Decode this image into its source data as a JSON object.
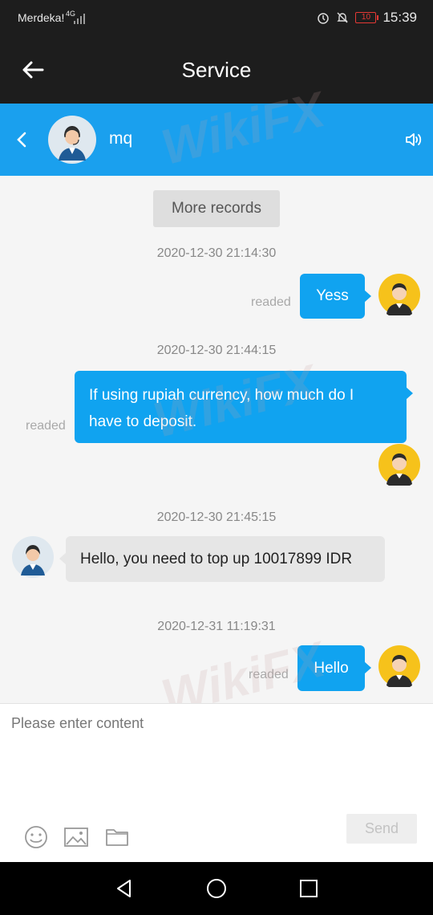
{
  "status_bar": {
    "carrier": "Merdeka!",
    "network": "4G",
    "battery": "10",
    "time": "15:39"
  },
  "title_bar": {
    "title": "Service"
  },
  "agent": {
    "name": "mq"
  },
  "chat": {
    "more_records": "More records",
    "messages": [
      {
        "time": "2020-12-30 21:14:30",
        "text": "Yess",
        "status": "readed"
      },
      {
        "time": "2020-12-30 21:44:15",
        "text_line1": "If using rupiah currency, how much do I",
        "text_line2": "have to deposit.",
        "status": "readed"
      },
      {
        "time": "2020-12-30 21:45:15",
        "text": "Hello, you need to top up 10017899 IDR"
      },
      {
        "time": "2020-12-31 11:19:31",
        "text": "Hello",
        "status": "readed"
      }
    ]
  },
  "watermark": "WikiFX",
  "input": {
    "placeholder": "Please enter content",
    "send_label": "Send"
  },
  "colors": {
    "accent": "#1aa0ee",
    "bubble_out": "#10a3f0",
    "bubble_in": "#e6e6e6",
    "dark_bar": "#1d1d1d"
  }
}
